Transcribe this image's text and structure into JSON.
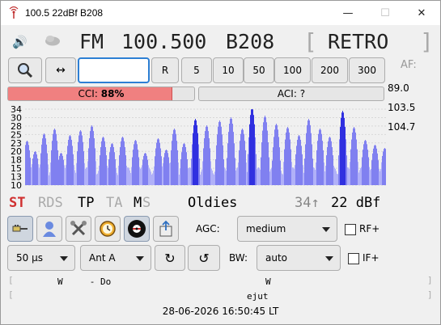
{
  "window": {
    "title": "100.5 22dBf B208",
    "minimize": "—",
    "maximize": "☐",
    "close": "✕"
  },
  "header": {
    "band": "FM",
    "frequency": "100.500",
    "pi": "B208",
    "ps": "RETRO",
    "bracket_open": "[",
    "bracket_close": "]"
  },
  "toolbar": {
    "search_icon": "magnifier-icon",
    "swap_label": "↔",
    "freq_input_value": "",
    "reset_label": "R",
    "steps": [
      "5",
      "10",
      "50",
      "100",
      "200",
      "300"
    ]
  },
  "af": {
    "label": "AF:",
    "items": [
      "89.0",
      "103.5",
      "104.7"
    ]
  },
  "meters": {
    "cci_label": "CCI:",
    "cci_value": "88%",
    "cci_fraction": 0.88,
    "aci_label": "ACI: ?"
  },
  "spectrum": {
    "y_ticks": [
      "34",
      "30",
      "28",
      "25",
      "23",
      "20",
      "18",
      "15",
      "13",
      "10"
    ],
    "colors": {
      "normal": "#8080f0",
      "highlight": "#3030e0",
      "light": "#b0b0f8"
    }
  },
  "status": {
    "st": "ST",
    "rds": "RDS",
    "tp": "TP",
    "ta": "TA",
    "m": "M",
    "s": "S",
    "pty": "Oldies",
    "tx_power": "34↑",
    "signal": "22 dBf",
    "colors": {
      "st": "#d03030",
      "inactive": "#aaaaaa",
      "active": "#000000"
    }
  },
  "controls": {
    "agc_label": "AGC:",
    "agc_value": "medium",
    "rf_label": "RF+",
    "deemphasis_value": "50 µs",
    "antenna_value": "Ant A",
    "bw_label": "BW:",
    "bw_value": "auto",
    "if_label": "IF+",
    "refresh_label": "↻",
    "undo_label": "↺"
  },
  "radiotext": {
    "line1": "W     - Do",
    "line1_right": "W",
    "line2": "ejut"
  },
  "clock": "28-06-2026 16:50:45 LT"
}
